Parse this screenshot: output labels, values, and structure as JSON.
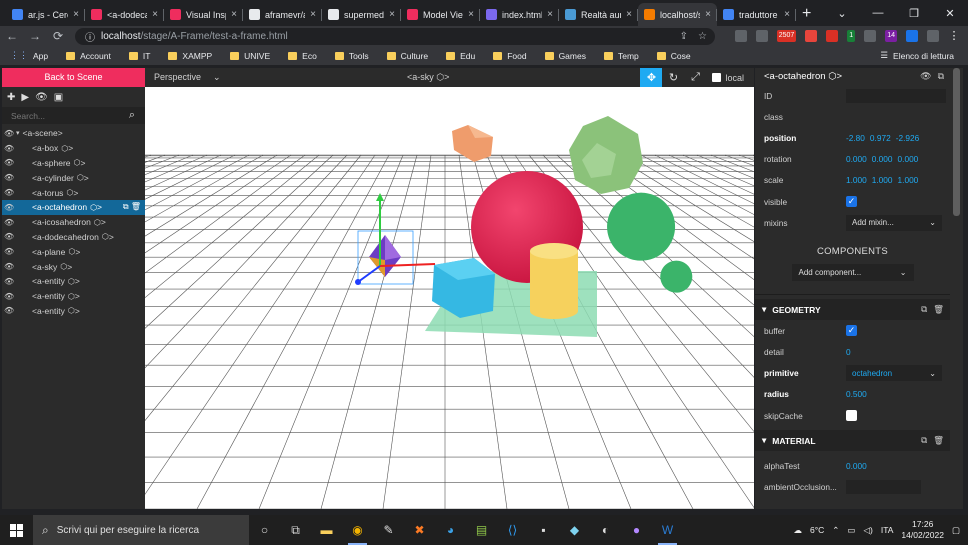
{
  "tabs": [
    {
      "title": "ar.js - Cerca",
      "color": "#4285f4",
      "active": false
    },
    {
      "title": "<a-dodecahedron>",
      "color": "#ef2d5e",
      "active": false
    },
    {
      "title": "Visual Inspector",
      "color": "#ef2d5e",
      "active": false
    },
    {
      "title": "aframevr/aframe",
      "color": "#e8eaed",
      "active": false
    },
    {
      "title": "supermedium",
      "color": "#e8eaed",
      "active": false
    },
    {
      "title": "Model Viewer",
      "color": "#ef2d5e",
      "active": false
    },
    {
      "title": "index.html",
      "color": "#7b68ee",
      "active": false
    },
    {
      "title": "Realtà aumentata",
      "color": "#4a9ad4",
      "active": false
    },
    {
      "title": "localhost/stage",
      "color": "#f57c00",
      "active": true
    },
    {
      "title": "traduttore",
      "color": "#4285f4",
      "active": false
    }
  ],
  "address": {
    "host": "localhost",
    "path": "/stage/A-Frame/test-a-frame.html"
  },
  "extensions": [
    {
      "label": "",
      "color": "#5f6368"
    },
    {
      "label": "",
      "color": "#5f6368"
    },
    {
      "label": "2507",
      "color": "#d93025"
    },
    {
      "label": "",
      "color": "#e8453c"
    },
    {
      "label": "",
      "color": "#d93025"
    },
    {
      "label": "1",
      "color": "#188038"
    },
    {
      "label": "",
      "color": "#5f6368"
    },
    {
      "label": "14",
      "color": "#7b1fa2"
    },
    {
      "label": "",
      "color": "#1a73e8"
    },
    {
      "label": "",
      "color": "#5f6368"
    }
  ],
  "bookmarks": [
    "App",
    "Account",
    "IT",
    "XAMPP",
    "UNIVE",
    "Eco",
    "Tools",
    "Culture",
    "Edu",
    "Food",
    "Games",
    "Temp",
    "Cose"
  ],
  "reading_list": "Elenco di lettura",
  "scene_panel": {
    "back_label": "Back to Scene",
    "search_placeholder": "Search...",
    "nodes": [
      {
        "label": "<a-scene>",
        "indent": 0,
        "selected": false
      },
      {
        "label": "<a-box",
        "suffix": ">",
        "indent": 1,
        "selected": false
      },
      {
        "label": "<a-sphere",
        "suffix": ">",
        "indent": 1,
        "selected": false
      },
      {
        "label": "<a-cylinder",
        "suffix": ">",
        "indent": 1,
        "selected": false
      },
      {
        "label": "<a-torus",
        "suffix": ">",
        "indent": 1,
        "selected": false
      },
      {
        "label": "<a-octahedron",
        "suffix": ">",
        "indent": 1,
        "selected": true
      },
      {
        "label": "<a-icosahedron",
        "suffix": ">",
        "indent": 1,
        "selected": false
      },
      {
        "label": "<a-dodecahedron",
        "suffix": ">",
        "indent": 1,
        "selected": false
      },
      {
        "label": "<a-plane",
        "suffix": ">",
        "indent": 1,
        "selected": false
      },
      {
        "label": "<a-sky",
        "suffix": ">",
        "indent": 1,
        "selected": false
      },
      {
        "label": "<a-entity",
        "suffix": ">",
        "indent": 1,
        "selected": false
      },
      {
        "label": "<a-entity",
        "suffix": ">",
        "indent": 1,
        "selected": false
      },
      {
        "label": "<a-entity",
        "suffix": ">",
        "indent": 1,
        "selected": false
      }
    ]
  },
  "viewport": {
    "camera": "Perspective",
    "title": "<a-sky",
    "title_suffix": ">",
    "local_label": "local"
  },
  "inspector": {
    "entity_title": "<a-octahedron",
    "title_suffix": ">",
    "props": {
      "id_label": "ID",
      "class_label": "class",
      "position_label": "position",
      "position": [
        "-2.80",
        "0.972",
        "-2.926"
      ],
      "rotation_label": "rotation",
      "rotation": [
        "0.000",
        "0.000",
        "0.000"
      ],
      "scale_label": "scale",
      "scale": [
        "1.000",
        "1.000",
        "1.000"
      ],
      "visible_label": "visible",
      "mixins_label": "mixins",
      "mixins_value": "Add mixin..."
    },
    "components_title": "COMPONENTS",
    "add_component": "Add component...",
    "geometry": {
      "title": "GEOMETRY",
      "buffer_label": "buffer",
      "detail_label": "detail",
      "detail": "0",
      "primitive_label": "primitive",
      "primitive": "octahedron",
      "radius_label": "radius",
      "radius": "0.500",
      "skipcache_label": "skipCache"
    },
    "material": {
      "title": "MATERIAL",
      "alphatest_label": "alphaTest",
      "alphatest": "0.000",
      "ao_label": "ambientOcclusion..."
    }
  },
  "taskbar": {
    "search_placeholder": "Scrivi qui per eseguire la ricerca",
    "weather": "6°C",
    "lang": "ITA",
    "time": "17:26",
    "date": "14/02/2022"
  },
  "colors": {
    "accent": "#ef2d5e",
    "selection": "#136899",
    "value": "#1faaf2"
  }
}
